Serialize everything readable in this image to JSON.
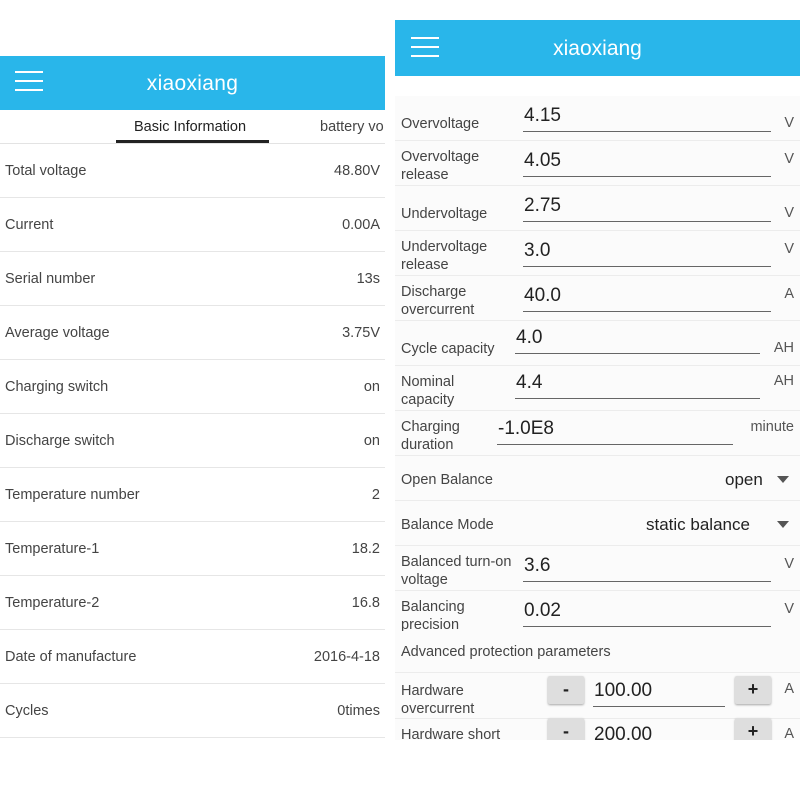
{
  "left": {
    "app_title": "xiaoxiang",
    "menu_icon": "hamburger-menu-icon",
    "tabs": [
      {
        "label": "Basic Information",
        "active": true
      },
      {
        "label": "battery vo",
        "active": false
      }
    ],
    "rows": [
      {
        "label": "Total voltage",
        "value": "48.80V"
      },
      {
        "label": "Current",
        "value": "0.00A"
      },
      {
        "label": "Serial number",
        "value": "13s"
      },
      {
        "label": "Average voltage",
        "value": "3.75V"
      },
      {
        "label": "Charging switch",
        "value": "on"
      },
      {
        "label": "Discharge switch",
        "value": "on"
      },
      {
        "label": "Temperature number",
        "value": "2"
      },
      {
        "label": "Temperature-1",
        "value": "18.2"
      },
      {
        "label": "Temperature-2",
        "value": "16.8"
      },
      {
        "label": "Date of manufacture",
        "value": "2016-4-18"
      },
      {
        "label": "Cycles",
        "value": "0times"
      }
    ]
  },
  "right": {
    "app_title": "xiaoxiang",
    "menu_icon": "hamburger-menu-icon",
    "params": [
      {
        "label_lines": [
          "Overvoltage"
        ],
        "value": "4.15",
        "unit": "V"
      },
      {
        "label_lines": [
          "Overvoltage",
          "release"
        ],
        "value": "4.05",
        "unit": "V"
      },
      {
        "label_lines": [
          "Undervoltage"
        ],
        "value": "2.75",
        "unit": "V"
      },
      {
        "label_lines": [
          "Undervoltage",
          "release"
        ],
        "value": "3.0",
        "unit": "V"
      },
      {
        "label_lines": [
          "Discharge",
          "overcurrent"
        ],
        "value": "40.0",
        "unit": "A"
      },
      {
        "label_lines": [
          "Cycle capacity"
        ],
        "value": "4.0",
        "unit": "AH"
      },
      {
        "label_lines": [
          "Nominal",
          "capacity"
        ],
        "value": "4.4",
        "unit": "AH"
      },
      {
        "label_lines": [
          "Charging",
          "duration"
        ],
        "value": "-1.0E8",
        "unit": "minute"
      }
    ],
    "open_balance": {
      "label": "Open Balance",
      "value": "open"
    },
    "balance_mode": {
      "label": "Balance Mode",
      "value": "static balance"
    },
    "balance_params": [
      {
        "label_lines": [
          "Balanced turn-on",
          "voltage"
        ],
        "value": "3.6",
        "unit": "V"
      },
      {
        "label_lines": [
          "Balancing",
          "precision"
        ],
        "value": "0.02",
        "unit": "V"
      }
    ],
    "advanced_header": "Advanced protection parameters",
    "hardware": [
      {
        "label_lines": [
          "Hardware",
          "overcurrent"
        ],
        "value": "100.00",
        "unit": "A",
        "minus": "-",
        "plus": "+"
      },
      {
        "label_lines": [
          "Hardware short"
        ],
        "value": "200.00",
        "unit": "A",
        "minus": "-",
        "plus": "+"
      }
    ]
  }
}
